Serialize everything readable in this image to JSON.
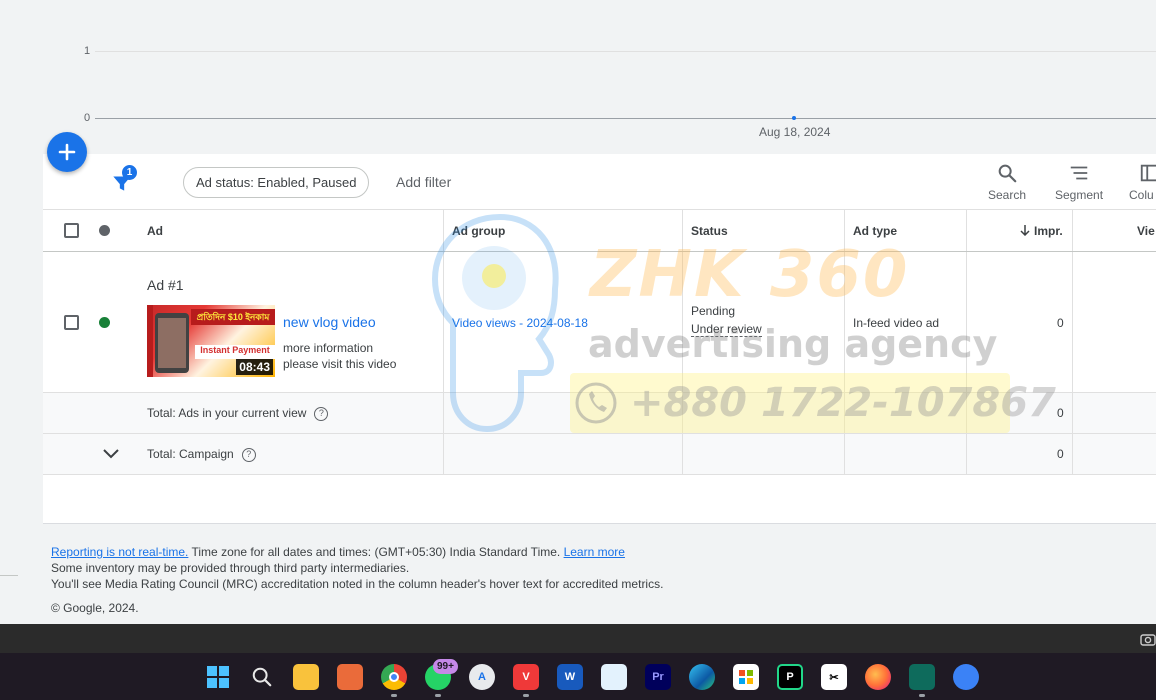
{
  "chart": {
    "y_ticks": [
      "1",
      "0"
    ],
    "x_label": "Aug 18, 2024"
  },
  "chart_data": {
    "type": "line",
    "x": [
      "Aug 18, 2024"
    ],
    "series": [
      {
        "values": [
          0
        ]
      }
    ],
    "ylim": [
      0,
      1
    ],
    "grid": true
  },
  "toolbar": {
    "filter_count": "1",
    "chip_label": "Ad status: Enabled, Paused",
    "add_filter_label": "Add filter",
    "search_label": "Search",
    "segment_label": "Segment",
    "columns_label": "Colu"
  },
  "table": {
    "headers": {
      "ad": "Ad",
      "ad_group": "Ad group",
      "status": "Status",
      "ad_type": "Ad type",
      "impr": "Impr.",
      "views": "Vie"
    },
    "row": {
      "ad_title": "Ad #1",
      "headline": "new vlog video",
      "description_line1": "more information",
      "description_line2": "please visit this video",
      "thumbnail_banner": "প্রতিদিন $10 ইনকাম",
      "thumbnail_text": "Instant Payment",
      "thumbnail_duration": "08:43",
      "ad_group": "Video views - 2024-08-18",
      "status_line1": "Pending",
      "status_line2": "Under review",
      "ad_type": "In-feed video ad",
      "impr": "0",
      "status_color": "#188038"
    },
    "totals": [
      {
        "label": "Total: Ads in your current view",
        "impr": "0"
      },
      {
        "label": "Total: Campaign",
        "impr": "0"
      }
    ]
  },
  "watermark": {
    "brand": "ZHK 360",
    "tagline": "advertising agency",
    "phone": "+880 1722-107867"
  },
  "footer": {
    "reporting_link": "Reporting is not real-time.",
    "timezone_text": " Time zone for all dates and times: (GMT+05:30) India Standard Time. ",
    "learn_more": "Learn more",
    "line2": "Some inventory may be provided through third party intermediaries.",
    "line3": "You'll see Media Rating Council (MRC) accreditation noted in the column header's hover text for accredited metrics.",
    "copyright": "© Google, 2024."
  },
  "taskbar": {
    "whatsapp_badge": "99+",
    "apps": [
      "start-icon",
      "search-icon",
      "file-explorer-icon",
      "snipping-tool-icon",
      "chrome-icon",
      "whatsapp-icon",
      "app-store-icon",
      "vivaldi-icon",
      "word-icon",
      "notepad-icon",
      "premiere-pro-icon",
      "edge-icon",
      "microsoft-store-icon",
      "pycharm-icon",
      "capcut-icon",
      "firefox-icon",
      "filmora-icon",
      "sync-icon"
    ]
  },
  "colors": {
    "accent": "#1a73e8",
    "enabled_green": "#188038"
  }
}
